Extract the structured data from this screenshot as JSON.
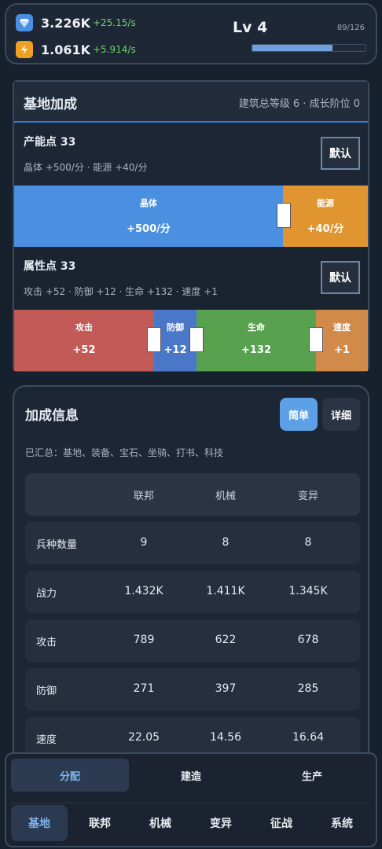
{
  "resources": [
    {
      "icon": "diamond-crystal-icon",
      "value": "3.226K",
      "rate": "+25.15/s",
      "color": "#4a90e2"
    },
    {
      "icon": "lightning-bolt-icon",
      "value": "1.061K",
      "rate": "+5.914/s",
      "color": "#f0a020"
    }
  ],
  "level": {
    "label": "Lv 4",
    "xp_text": "89/126",
    "xp_fraction": 0.706
  },
  "base_bonus": {
    "title": "基地加成",
    "meta": "建筑总等级 6 · 成长阶位 0",
    "production": {
      "title": "产能点 33",
      "subtitle": "晶体 +500/分 · 能源 +40/分",
      "default_label": "默认",
      "segments": [
        {
          "name": "晶体",
          "value": "+500/分",
          "color": "#4a8fe0"
        },
        {
          "name": "能源",
          "value": "+40/分",
          "color": "#e09530"
        }
      ]
    },
    "attributes": {
      "title": "属性点 33",
      "subtitle": "攻击 +52 · 防御 +12 · 生命 +132 · 速度 +1",
      "default_label": "默认",
      "segments": [
        {
          "name": "攻击",
          "value": "+52",
          "color": "#c25a58"
        },
        {
          "name": "防御",
          "value": "+12",
          "color": "#4b77c9"
        },
        {
          "name": "生命",
          "value": "+132",
          "color": "#58a14f"
        },
        {
          "name": "速度",
          "value": "+1",
          "color": "#d28a4a"
        }
      ]
    }
  },
  "bonus_info": {
    "title": "加成信息",
    "simple_label": "简单",
    "detail_label": "详细",
    "summary": "已汇总：基地、装备、宝石、坐骑、打书、科技",
    "columns": [
      "联邦",
      "机械",
      "变异"
    ],
    "rows": [
      {
        "label": "兵种数量",
        "values": [
          "9",
          "8",
          "8"
        ]
      },
      {
        "label": "战力",
        "values": [
          "1.432K",
          "1.411K",
          "1.345K"
        ]
      },
      {
        "label": "攻击",
        "values": [
          "789",
          "622",
          "678"
        ]
      },
      {
        "label": "防御",
        "values": [
          "271",
          "397",
          "285"
        ]
      },
      {
        "label": "速度",
        "values": [
          "22.05",
          "14.56",
          "16.64"
        ]
      }
    ]
  },
  "sub_tabs": [
    {
      "label": "分配",
      "active": true
    },
    {
      "label": "建造",
      "active": false
    },
    {
      "label": "生产",
      "active": false
    }
  ],
  "main_tabs": [
    {
      "label": "基地",
      "active": true
    },
    {
      "label": "联邦",
      "active": false
    },
    {
      "label": "机械",
      "active": false
    },
    {
      "label": "变异",
      "active": false
    },
    {
      "label": "征战",
      "active": false
    },
    {
      "label": "系统",
      "active": false
    }
  ]
}
